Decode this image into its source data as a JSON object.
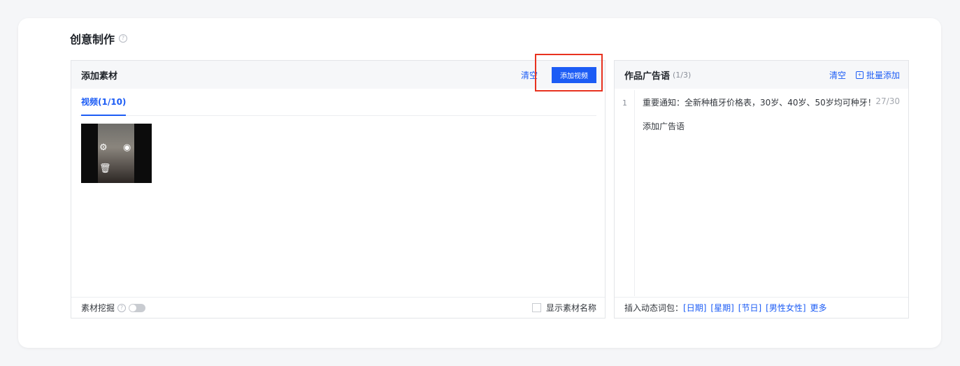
{
  "section": {
    "title": "创意制作"
  },
  "materials": {
    "header": "添加素材",
    "clear": "清空",
    "add_video": "添加视频",
    "tab": "视频(1/10)",
    "thumbnail_icons": [
      "settings-icon",
      "eye-icon",
      "trash-icon"
    ],
    "footer": {
      "mining_label": "素材挖掘",
      "show_name_label": "显示素材名称"
    }
  },
  "ads": {
    "header": "作品广告语",
    "count": "(1/3)",
    "clear": "清空",
    "batch_add": "批量添加",
    "lines": [
      {
        "num": "1",
        "text": "重要通知：全新种植牙价格表，30岁、40岁、50岁均可种牙！",
        "count": "27/30"
      }
    ],
    "placeholder": "添加广告语",
    "footer": {
      "label": "插入动态词包：",
      "tags": [
        "[日期]",
        "[星期]",
        "[节日]",
        "[男性女性]",
        "更多"
      ]
    }
  },
  "colors": {
    "accent": "#1c5cf5",
    "highlight": "#e8321f"
  }
}
